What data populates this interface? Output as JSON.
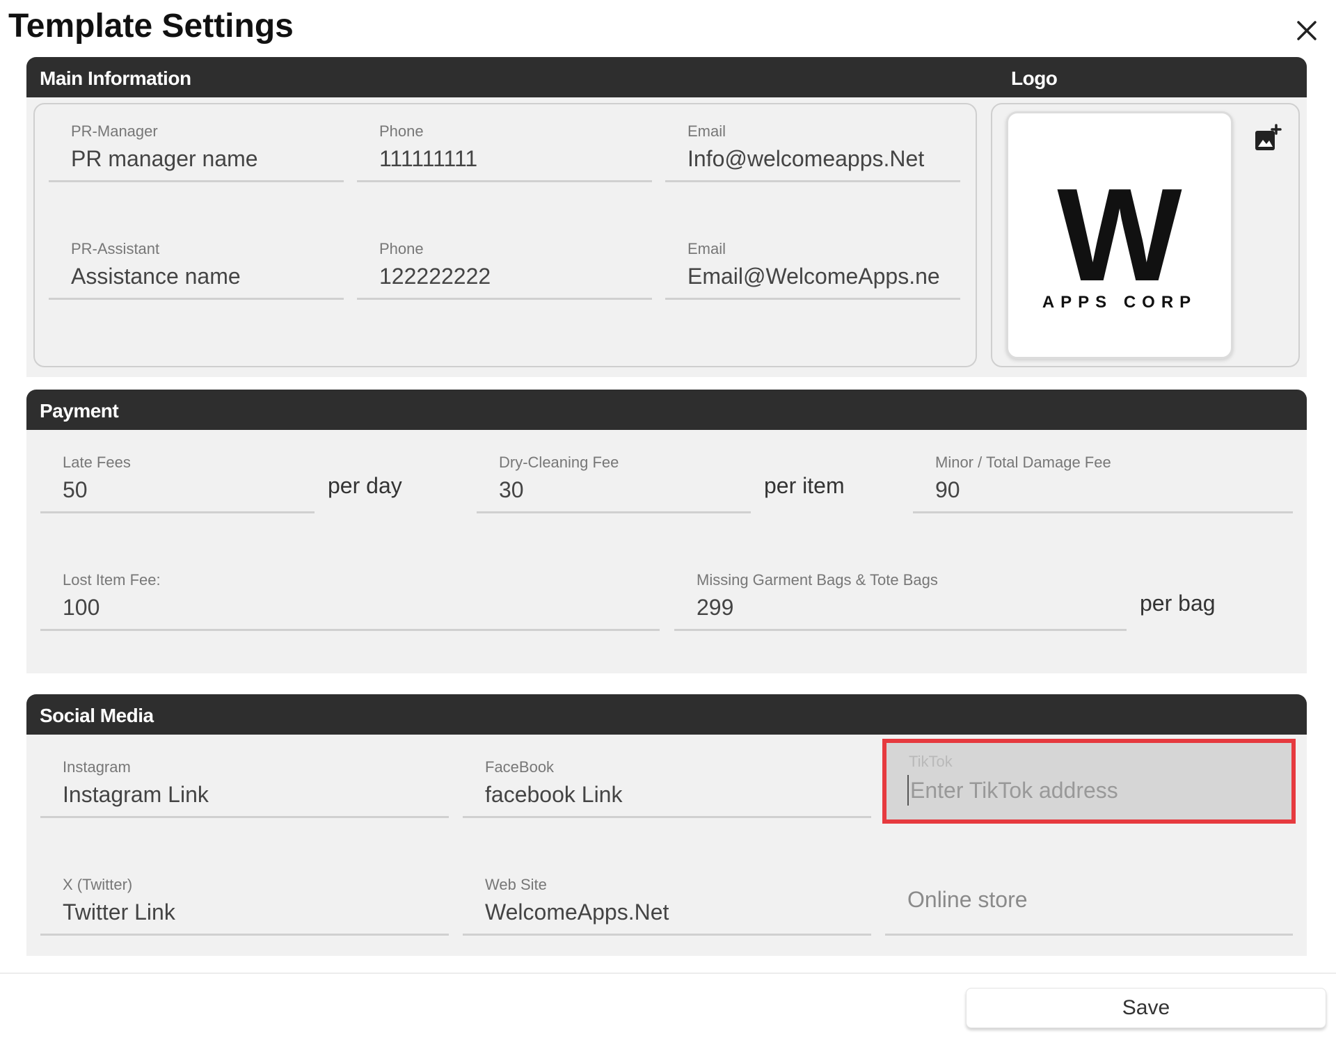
{
  "dialog": {
    "title": "Template Settings",
    "close_icon": "close-icon"
  },
  "main_information": {
    "header": "Main Information",
    "logo_header": "Logo",
    "pr_manager": {
      "label": "PR-Manager",
      "value": "PR manager name"
    },
    "pr_manager_phone": {
      "label": "Phone",
      "value": "111111111"
    },
    "pr_manager_email": {
      "label": "Email",
      "value": "Info@welcomeapps.Net"
    },
    "pr_assistant": {
      "label": "PR-Assistant",
      "value": "Assistance name"
    },
    "pr_assistant_phone": {
      "label": "Phone",
      "value": "122222222"
    },
    "pr_assistant_email": {
      "label": "Email",
      "value": "Email@WelcomeApps.ne"
    },
    "logo": {
      "letter": "W",
      "subtitle": "APPS CORP",
      "upload_icon": "add-photo-icon"
    }
  },
  "payment": {
    "header": "Payment",
    "late_fees": {
      "label": "Late Fees",
      "value": "50",
      "suffix": "per day"
    },
    "dry_cleaning_fee": {
      "label": "Dry-Cleaning Fee",
      "value": "30",
      "suffix": "per item"
    },
    "damage_fee": {
      "label": "Minor / Total Damage Fee",
      "value": "90"
    },
    "lost_item_fee": {
      "label": "Lost Item Fee:",
      "value": "100"
    },
    "missing_bags": {
      "label": "Missing Garment Bags & Tote Bags",
      "value": "299",
      "suffix": "per bag"
    }
  },
  "social_media": {
    "header": "Social Media",
    "instagram": {
      "label": "Instagram",
      "value": "Instagram Link"
    },
    "facebook": {
      "label": "FaceBook",
      "value": "facebook Link"
    },
    "tiktok": {
      "label": "TikTok",
      "placeholder": "Enter TikTok address",
      "value": ""
    },
    "twitter": {
      "label": "X (Twitter)",
      "value": "Twitter Link"
    },
    "website": {
      "label": "Web Site",
      "value": "WelcomeApps.Net"
    },
    "online_store": {
      "placeholder": "Online store"
    }
  },
  "footer": {
    "save_label": "Save"
  }
}
